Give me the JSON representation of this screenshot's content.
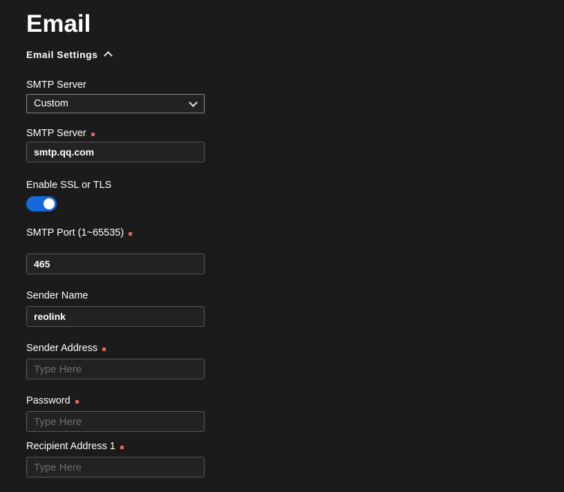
{
  "page": {
    "title": "Email",
    "background_color": "#1b1b1b"
  },
  "section": {
    "label": "Email Settings",
    "toggle_icon": "chevron-up-icon",
    "expanded": true
  },
  "colors": {
    "accent": "#1668dc",
    "required_marker": "#e8625a",
    "input_bg": "#222222",
    "input_border": "#595959",
    "select_border": "#8a8a8a",
    "placeholder": "#6f6f6f"
  },
  "fields": {
    "smtp_server_select": {
      "label": "SMTP Server",
      "value": "Custom",
      "required": false,
      "icon": "chevron-down-icon",
      "options": [
        "Custom"
      ]
    },
    "smtp_server_host": {
      "label": "SMTP Server",
      "value": "smtp.qq.com",
      "placeholder": "Type Here",
      "required": true
    },
    "enable_ssl": {
      "label": "Enable SSL or TLS",
      "value": "on",
      "required": false
    },
    "smtp_port": {
      "label": "SMTP Port (1~65535)",
      "value": "465",
      "placeholder": "Type Here",
      "required": true
    },
    "sender_name": {
      "label": "Sender Name",
      "value": "reolink",
      "placeholder": "Type Here",
      "required": false
    },
    "sender_address": {
      "label": "Sender Address",
      "value": "",
      "placeholder": "Type Here",
      "required": true
    },
    "password": {
      "label": "Password",
      "value": "",
      "placeholder": "Type Here",
      "required": true
    },
    "recipient_address_1": {
      "label": "Recipient Address 1",
      "value": "",
      "placeholder": "Type Here",
      "required": true
    }
  }
}
